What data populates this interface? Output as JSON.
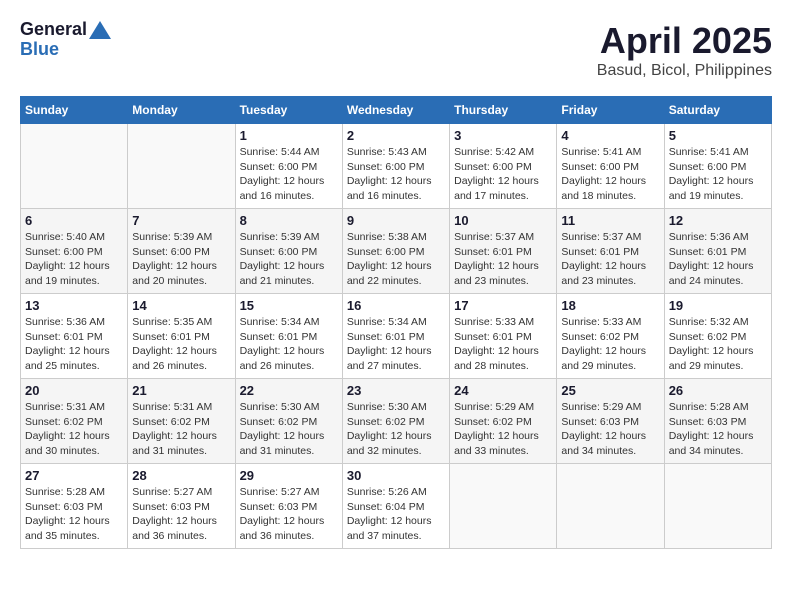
{
  "header": {
    "logo_general": "General",
    "logo_blue": "Blue",
    "month": "April 2025",
    "location": "Basud, Bicol, Philippines"
  },
  "weekdays": [
    "Sunday",
    "Monday",
    "Tuesday",
    "Wednesday",
    "Thursday",
    "Friday",
    "Saturday"
  ],
  "weeks": [
    [
      {
        "day": "",
        "info": ""
      },
      {
        "day": "",
        "info": ""
      },
      {
        "day": "1",
        "info": "Sunrise: 5:44 AM\nSunset: 6:00 PM\nDaylight: 12 hours and 16 minutes."
      },
      {
        "day": "2",
        "info": "Sunrise: 5:43 AM\nSunset: 6:00 PM\nDaylight: 12 hours and 16 minutes."
      },
      {
        "day": "3",
        "info": "Sunrise: 5:42 AM\nSunset: 6:00 PM\nDaylight: 12 hours and 17 minutes."
      },
      {
        "day": "4",
        "info": "Sunrise: 5:41 AM\nSunset: 6:00 PM\nDaylight: 12 hours and 18 minutes."
      },
      {
        "day": "5",
        "info": "Sunrise: 5:41 AM\nSunset: 6:00 PM\nDaylight: 12 hours and 19 minutes."
      }
    ],
    [
      {
        "day": "6",
        "info": "Sunrise: 5:40 AM\nSunset: 6:00 PM\nDaylight: 12 hours and 19 minutes."
      },
      {
        "day": "7",
        "info": "Sunrise: 5:39 AM\nSunset: 6:00 PM\nDaylight: 12 hours and 20 minutes."
      },
      {
        "day": "8",
        "info": "Sunrise: 5:39 AM\nSunset: 6:00 PM\nDaylight: 12 hours and 21 minutes."
      },
      {
        "day": "9",
        "info": "Sunrise: 5:38 AM\nSunset: 6:00 PM\nDaylight: 12 hours and 22 minutes."
      },
      {
        "day": "10",
        "info": "Sunrise: 5:37 AM\nSunset: 6:01 PM\nDaylight: 12 hours and 23 minutes."
      },
      {
        "day": "11",
        "info": "Sunrise: 5:37 AM\nSunset: 6:01 PM\nDaylight: 12 hours and 23 minutes."
      },
      {
        "day": "12",
        "info": "Sunrise: 5:36 AM\nSunset: 6:01 PM\nDaylight: 12 hours and 24 minutes."
      }
    ],
    [
      {
        "day": "13",
        "info": "Sunrise: 5:36 AM\nSunset: 6:01 PM\nDaylight: 12 hours and 25 minutes."
      },
      {
        "day": "14",
        "info": "Sunrise: 5:35 AM\nSunset: 6:01 PM\nDaylight: 12 hours and 26 minutes."
      },
      {
        "day": "15",
        "info": "Sunrise: 5:34 AM\nSunset: 6:01 PM\nDaylight: 12 hours and 26 minutes."
      },
      {
        "day": "16",
        "info": "Sunrise: 5:34 AM\nSunset: 6:01 PM\nDaylight: 12 hours and 27 minutes."
      },
      {
        "day": "17",
        "info": "Sunrise: 5:33 AM\nSunset: 6:01 PM\nDaylight: 12 hours and 28 minutes."
      },
      {
        "day": "18",
        "info": "Sunrise: 5:33 AM\nSunset: 6:02 PM\nDaylight: 12 hours and 29 minutes."
      },
      {
        "day": "19",
        "info": "Sunrise: 5:32 AM\nSunset: 6:02 PM\nDaylight: 12 hours and 29 minutes."
      }
    ],
    [
      {
        "day": "20",
        "info": "Sunrise: 5:31 AM\nSunset: 6:02 PM\nDaylight: 12 hours and 30 minutes."
      },
      {
        "day": "21",
        "info": "Sunrise: 5:31 AM\nSunset: 6:02 PM\nDaylight: 12 hours and 31 minutes."
      },
      {
        "day": "22",
        "info": "Sunrise: 5:30 AM\nSunset: 6:02 PM\nDaylight: 12 hours and 31 minutes."
      },
      {
        "day": "23",
        "info": "Sunrise: 5:30 AM\nSunset: 6:02 PM\nDaylight: 12 hours and 32 minutes."
      },
      {
        "day": "24",
        "info": "Sunrise: 5:29 AM\nSunset: 6:02 PM\nDaylight: 12 hours and 33 minutes."
      },
      {
        "day": "25",
        "info": "Sunrise: 5:29 AM\nSunset: 6:03 PM\nDaylight: 12 hours and 34 minutes."
      },
      {
        "day": "26",
        "info": "Sunrise: 5:28 AM\nSunset: 6:03 PM\nDaylight: 12 hours and 34 minutes."
      }
    ],
    [
      {
        "day": "27",
        "info": "Sunrise: 5:28 AM\nSunset: 6:03 PM\nDaylight: 12 hours and 35 minutes."
      },
      {
        "day": "28",
        "info": "Sunrise: 5:27 AM\nSunset: 6:03 PM\nDaylight: 12 hours and 36 minutes."
      },
      {
        "day": "29",
        "info": "Sunrise: 5:27 AM\nSunset: 6:03 PM\nDaylight: 12 hours and 36 minutes."
      },
      {
        "day": "30",
        "info": "Sunrise: 5:26 AM\nSunset: 6:04 PM\nDaylight: 12 hours and 37 minutes."
      },
      {
        "day": "",
        "info": ""
      },
      {
        "day": "",
        "info": ""
      },
      {
        "day": "",
        "info": ""
      }
    ]
  ]
}
